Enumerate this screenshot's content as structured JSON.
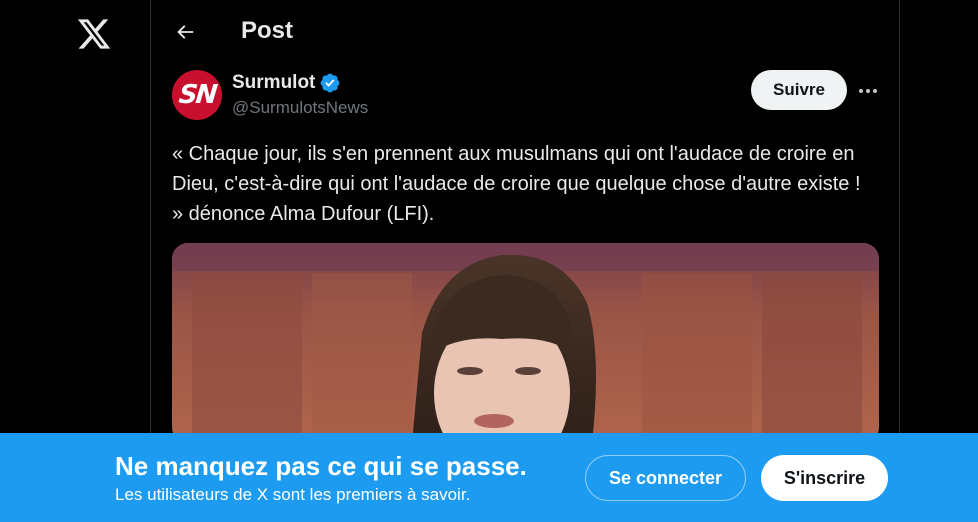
{
  "nav": {
    "logo_icon": "x-logo-icon"
  },
  "header": {
    "back_icon": "arrow-left-icon",
    "title": "Post"
  },
  "post": {
    "avatar_text": "SN",
    "author_name": "Surmulot",
    "verified_icon": "verified-badge-icon",
    "author_handle": "@SurmulotsNews",
    "follow_label": "Suivre",
    "more_icon": "more-dots-icon",
    "text": "« Chaque jour, ils s'en prennent aux musulmans qui ont l'audace de croire en Dieu, c'est-à-dire qui ont l'audace de croire que quelque chose d'autre existe ! » dénonce Alma Dufour (LFI)."
  },
  "banner": {
    "title": "Ne manquez pas ce qui se passe.",
    "subtitle": "Les utilisateurs de X sont les premiers à savoir.",
    "login_label": "Se connecter",
    "signup_label": "S'inscrire"
  },
  "colors": {
    "accent": "#1d9bf0",
    "background": "#000000",
    "avatar_red": "#c8102e"
  }
}
